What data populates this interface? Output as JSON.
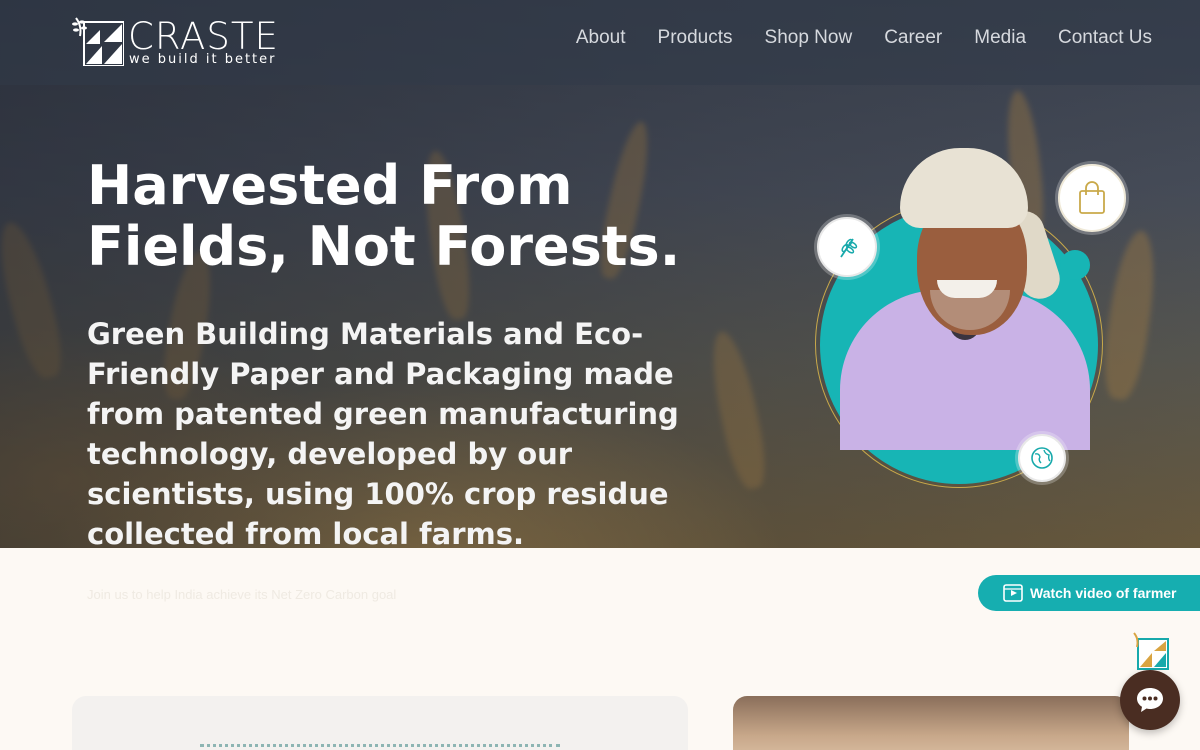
{
  "brand": {
    "name": "CRASTE",
    "tagline": "we build it better"
  },
  "nav": {
    "items": [
      {
        "label": "About"
      },
      {
        "label": "Products"
      },
      {
        "label": "Shop Now"
      },
      {
        "label": "Career"
      },
      {
        "label": "Media"
      },
      {
        "label": "Contact Us"
      }
    ]
  },
  "hero": {
    "title": "Harvested From Fields, Not Forests.",
    "subtitle": "Green Building Materials and Eco-Friendly Paper and Packaging made from patented green manufacturing technology, developed by our scientists, using 100% crop residue collected from local farms."
  },
  "cta": {
    "tagline": "Join us to help India achieve its Net Zero Carbon goal",
    "watch_video_label": "Watch video of farmer"
  },
  "colors": {
    "accent_teal": "#16aeb0",
    "ring_gold": "#c9a94a",
    "chat_brown": "#4a2d22",
    "page_bg": "#fdf9f4"
  },
  "icons": {
    "badge_top_left": "wheat-icon",
    "badge_top_right": "shopping-bag-icon",
    "badge_bottom": "globe-icon",
    "watch_button": "video-icon",
    "chat": "chat-bubble-icon"
  }
}
